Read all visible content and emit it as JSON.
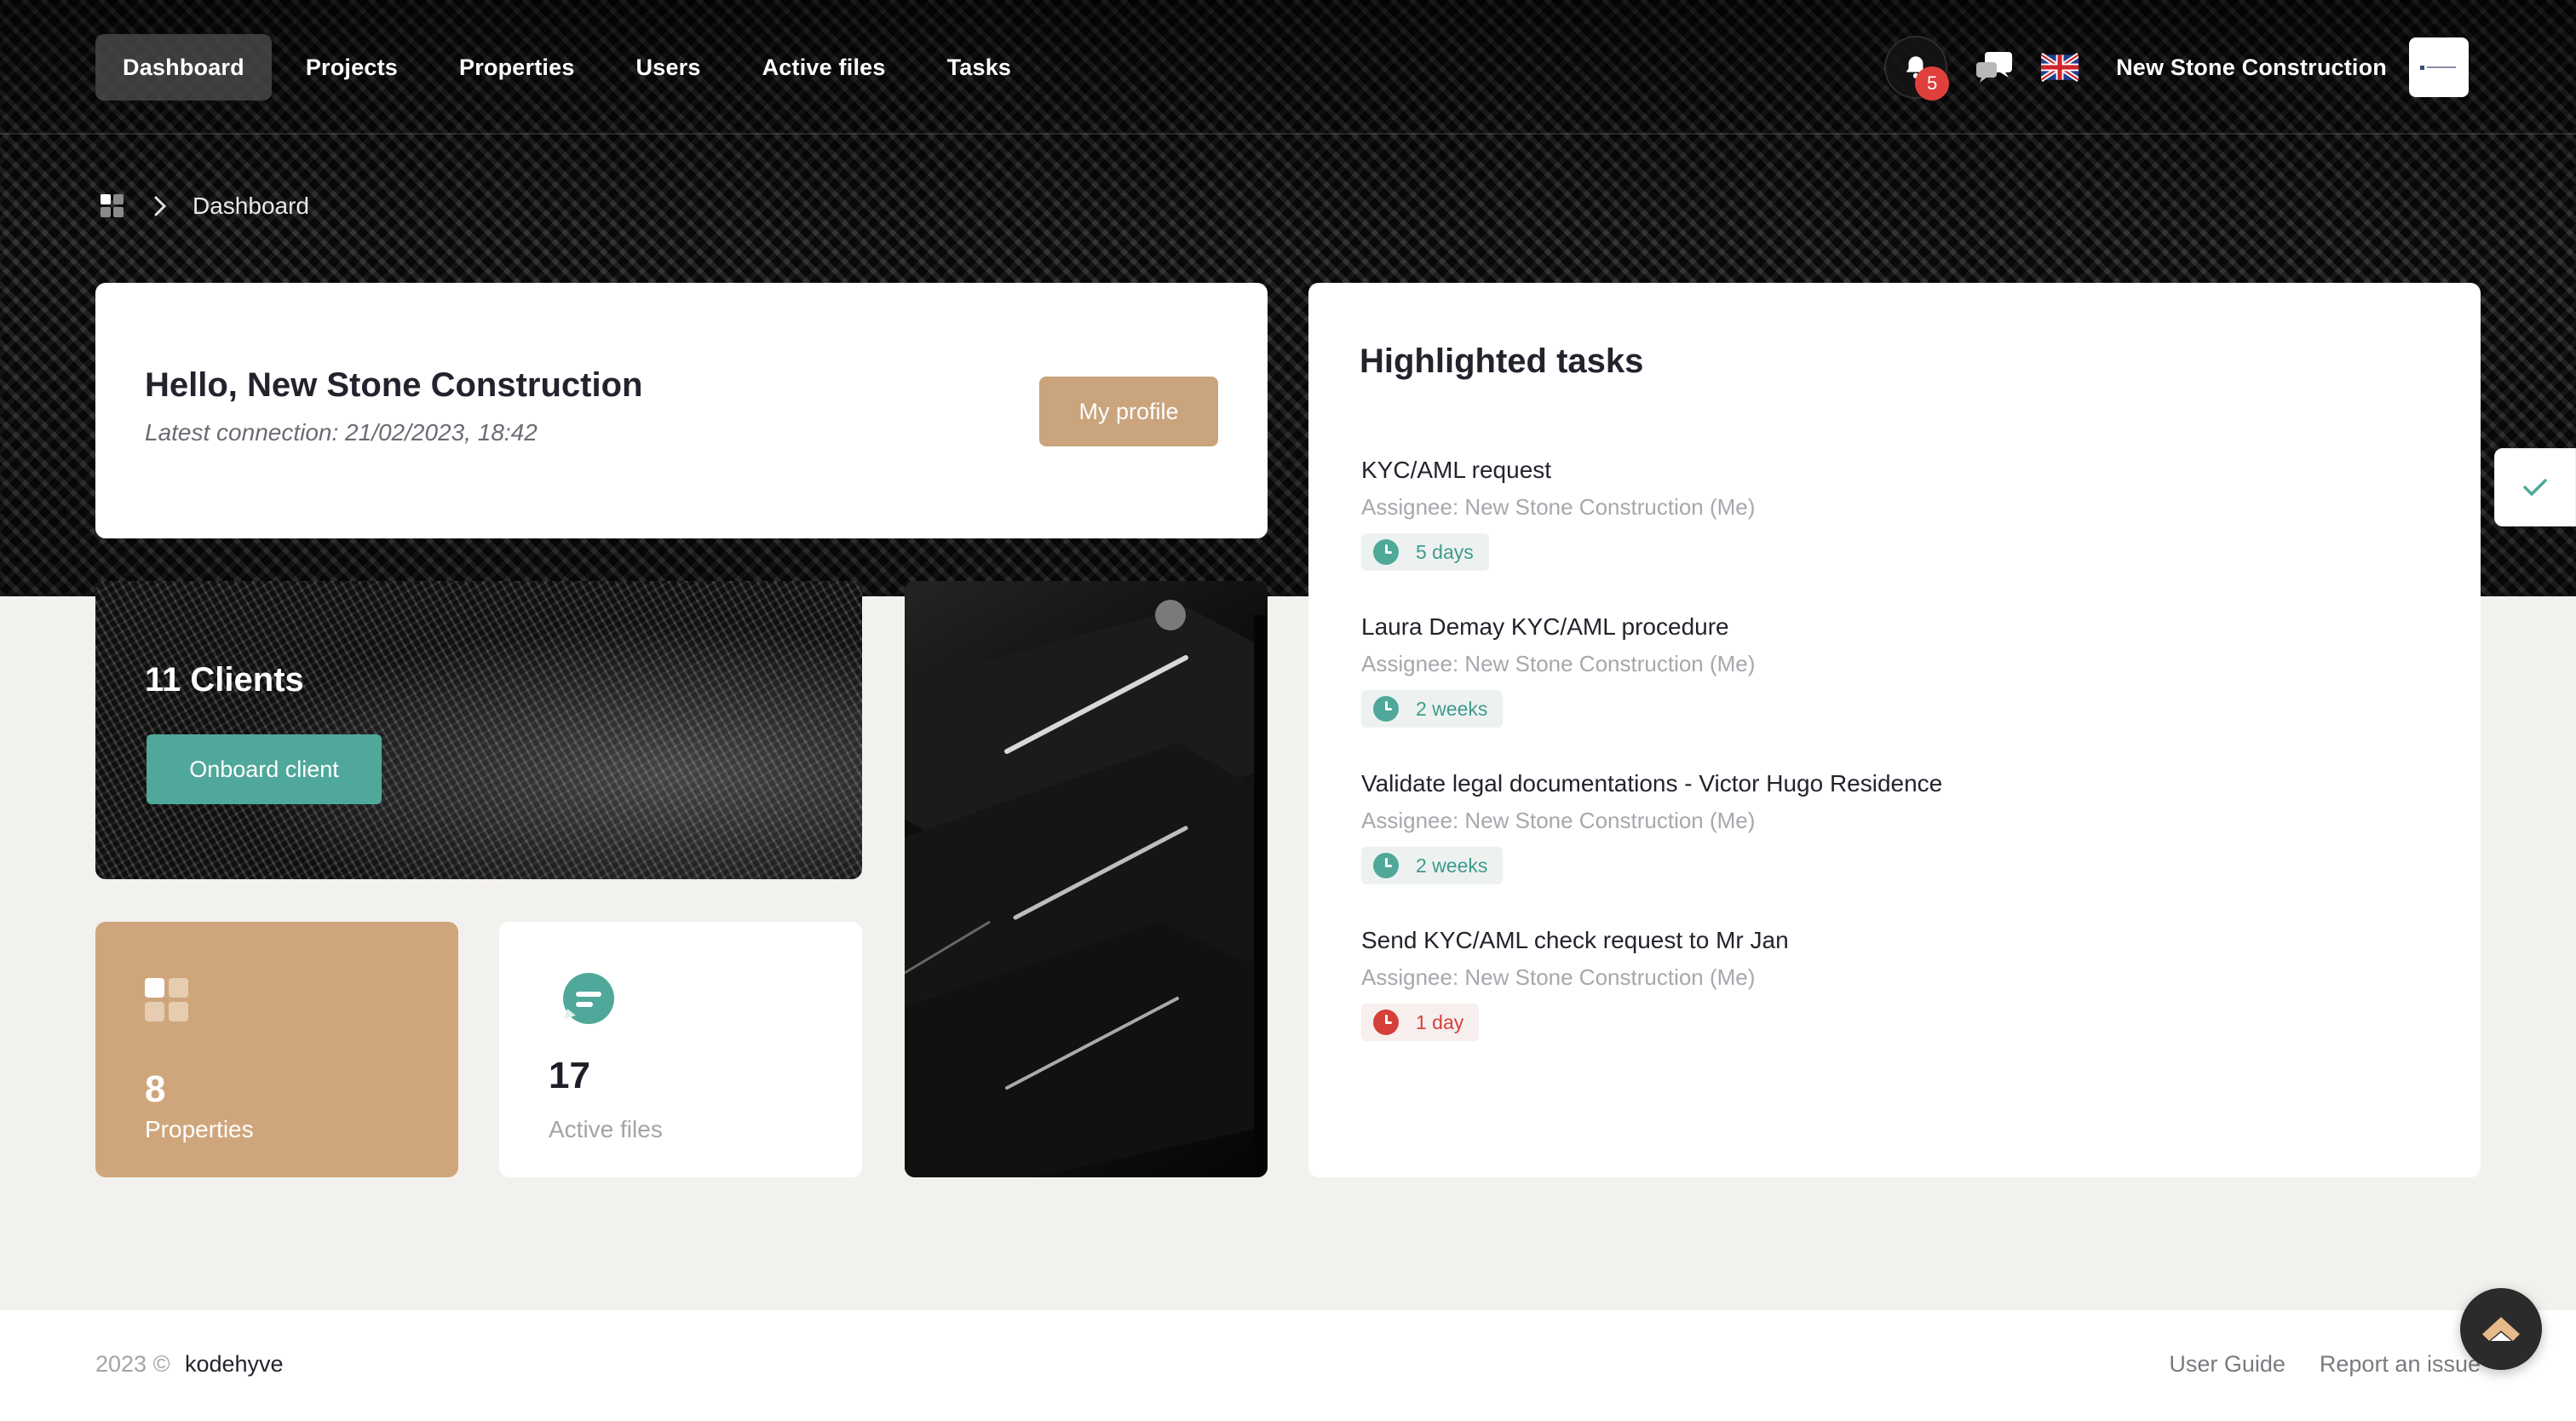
{
  "nav": {
    "items": [
      {
        "label": "Dashboard",
        "active": true
      },
      {
        "label": "Projects",
        "active": false
      },
      {
        "label": "Properties",
        "active": false
      },
      {
        "label": "Users",
        "active": false
      },
      {
        "label": "Active files",
        "active": false
      },
      {
        "label": "Tasks",
        "active": false
      }
    ],
    "notification_count": "5",
    "company_name": "New Stone Construction",
    "language_flag": "uk-flag-icon"
  },
  "breadcrumb": {
    "home_icon": "grid-icon",
    "current": "Dashboard"
  },
  "hello": {
    "title": "Hello, New Stone Construction",
    "latest_connection": "Latest connection: 21/02/2023, 18:42",
    "profile_button": "My profile"
  },
  "clients": {
    "title": "11 Clients",
    "onboard_button": "Onboard client"
  },
  "stats": {
    "properties": {
      "count": "8",
      "label": "Properties"
    },
    "active_files": {
      "count": "17",
      "label": "Active files"
    }
  },
  "tasks": {
    "title": "Highlighted tasks",
    "items": [
      {
        "title": "KYC/AML request",
        "assignee": "Assignee: New Stone Construction (Me)",
        "due": "5 days",
        "status": "ok"
      },
      {
        "title": "Laura Demay KYC/AML procedure",
        "assignee": "Assignee: New Stone Construction (Me)",
        "due": "2 weeks",
        "status": "ok"
      },
      {
        "title": "Validate legal documentations - Victor Hugo Residence",
        "assignee": "Assignee: New Stone Construction (Me)",
        "due": "2 weeks",
        "status": "ok"
      },
      {
        "title": "Send KYC/AML check request to Mr Jan",
        "assignee": "Assignee: New Stone Construction (Me)",
        "due": "1 day",
        "status": "late"
      }
    ]
  },
  "footer": {
    "copyright": "2023 ©",
    "brand": "kodehyve",
    "user_guide": "User Guide",
    "report_issue": "Report an issue"
  },
  "colors": {
    "accent_tan": "#c9a47d",
    "accent_teal": "#4fa89a",
    "danger": "#d6403b"
  }
}
